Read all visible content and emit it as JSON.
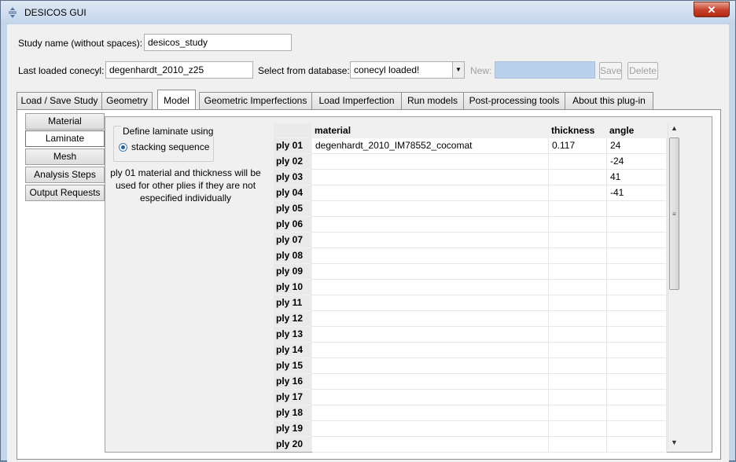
{
  "window": {
    "title": "DESICOS GUI",
    "close_symbol": "✕"
  },
  "study": {
    "label": "Study name (without spaces):",
    "value": "desicos_study"
  },
  "conecyl": {
    "last_label": "Last loaded conecyl:",
    "last_value": "degenhardt_2010_z25",
    "select_label": "Select from database:",
    "select_value": "conecyl loaded!",
    "new_label": "New:",
    "new_value": "",
    "save_label": "Save",
    "delete_label": "Delete"
  },
  "tabs": [
    {
      "label": "Load / Save Study"
    },
    {
      "label": "Geometry"
    },
    {
      "label": "Model"
    },
    {
      "label": "Geometric Imperfections"
    },
    {
      "label": "Load Imperfection"
    },
    {
      "label": "Run models"
    },
    {
      "label": "Post-processing tools"
    },
    {
      "label": "About this plug-in"
    }
  ],
  "side_tabs": [
    {
      "label": "Material"
    },
    {
      "label": "Laminate"
    },
    {
      "label": "Mesh"
    },
    {
      "label": "Analysis Steps"
    },
    {
      "label": "Output Requests"
    }
  ],
  "laminate": {
    "group_title": "Define laminate using",
    "radio_label": "stacking sequence",
    "note_line1": "ply 01 material and thickness will be",
    "note_line2": "used for other plies if they are not",
    "note_line3": "especified individually"
  },
  "table": {
    "headers": {
      "material": "material",
      "thickness": "thickness",
      "angle": "angle"
    },
    "rows": [
      {
        "label": "ply 01",
        "material": "degenhardt_2010_IM78552_cocomat",
        "thickness": "0.117",
        "angle": "24"
      },
      {
        "label": "ply 02",
        "material": "",
        "thickness": "",
        "angle": "-24"
      },
      {
        "label": "ply 03",
        "material": "",
        "thickness": "",
        "angle": "41"
      },
      {
        "label": "ply 04",
        "material": "",
        "thickness": "",
        "angle": "-41"
      },
      {
        "label": "ply 05",
        "material": "",
        "thickness": "",
        "angle": ""
      },
      {
        "label": "ply 06",
        "material": "",
        "thickness": "",
        "angle": ""
      },
      {
        "label": "ply 07",
        "material": "",
        "thickness": "",
        "angle": ""
      },
      {
        "label": "ply 08",
        "material": "",
        "thickness": "",
        "angle": ""
      },
      {
        "label": "ply 09",
        "material": "",
        "thickness": "",
        "angle": ""
      },
      {
        "label": "ply 10",
        "material": "",
        "thickness": "",
        "angle": ""
      },
      {
        "label": "ply 11",
        "material": "",
        "thickness": "",
        "angle": ""
      },
      {
        "label": "ply 12",
        "material": "",
        "thickness": "",
        "angle": ""
      },
      {
        "label": "ply 13",
        "material": "",
        "thickness": "",
        "angle": ""
      },
      {
        "label": "ply 14",
        "material": "",
        "thickness": "",
        "angle": ""
      },
      {
        "label": "ply 15",
        "material": "",
        "thickness": "",
        "angle": ""
      },
      {
        "label": "ply 16",
        "material": "",
        "thickness": "",
        "angle": ""
      },
      {
        "label": "ply 17",
        "material": "",
        "thickness": "",
        "angle": ""
      },
      {
        "label": "ply 18",
        "material": "",
        "thickness": "",
        "angle": ""
      },
      {
        "label": "ply 19",
        "material": "",
        "thickness": "",
        "angle": ""
      },
      {
        "label": "ply 20",
        "material": "",
        "thickness": "",
        "angle": ""
      }
    ]
  },
  "colors": {
    "new_field_bg": "#b9d1ea",
    "close_red": "#c7402a"
  }
}
